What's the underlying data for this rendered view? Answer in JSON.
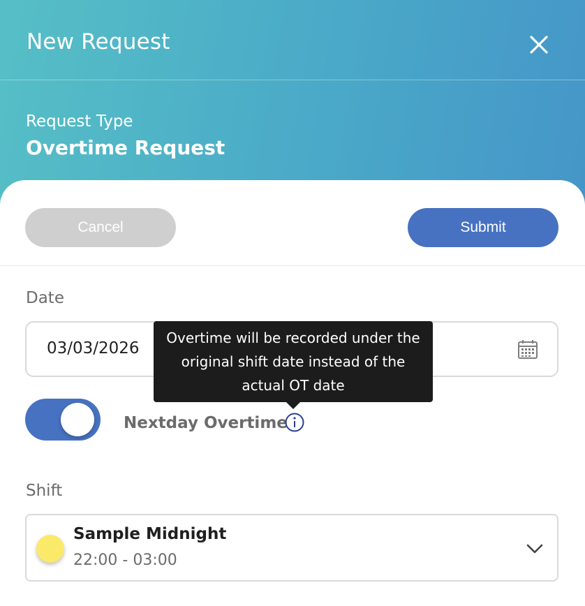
{
  "header": {
    "title": "New Request",
    "close_icon": "close-icon"
  },
  "request_type": {
    "label": "Request Type",
    "value": "Overtime Request"
  },
  "actions": {
    "cancel_label": "Cancel",
    "submit_label": "Submit"
  },
  "date": {
    "label": "Date",
    "value": "03/03/2026",
    "icon": "calendar-icon"
  },
  "nextday_overtime": {
    "label": "Nextday Overtime",
    "enabled": true,
    "info_icon": "info-icon",
    "tooltip": {
      "line1": "Overtime will be recorded under the",
      "line2": "original shift date instead of the",
      "line3": "actual OT date"
    }
  },
  "shift": {
    "label": "Shift",
    "name": "Sample Midnight",
    "time": "22:00 - 03:00",
    "icon": "sun-dot-icon",
    "dropdown_icon": "chevron-down-icon"
  },
  "colors": {
    "gradient_start": "#56bfc6",
    "gradient_end": "#4596c8",
    "primary": "#4672c1",
    "cancel_bg": "#cfcfcf",
    "tooltip_bg": "#1c1c1c",
    "shift_dot": "#fbe96a"
  }
}
